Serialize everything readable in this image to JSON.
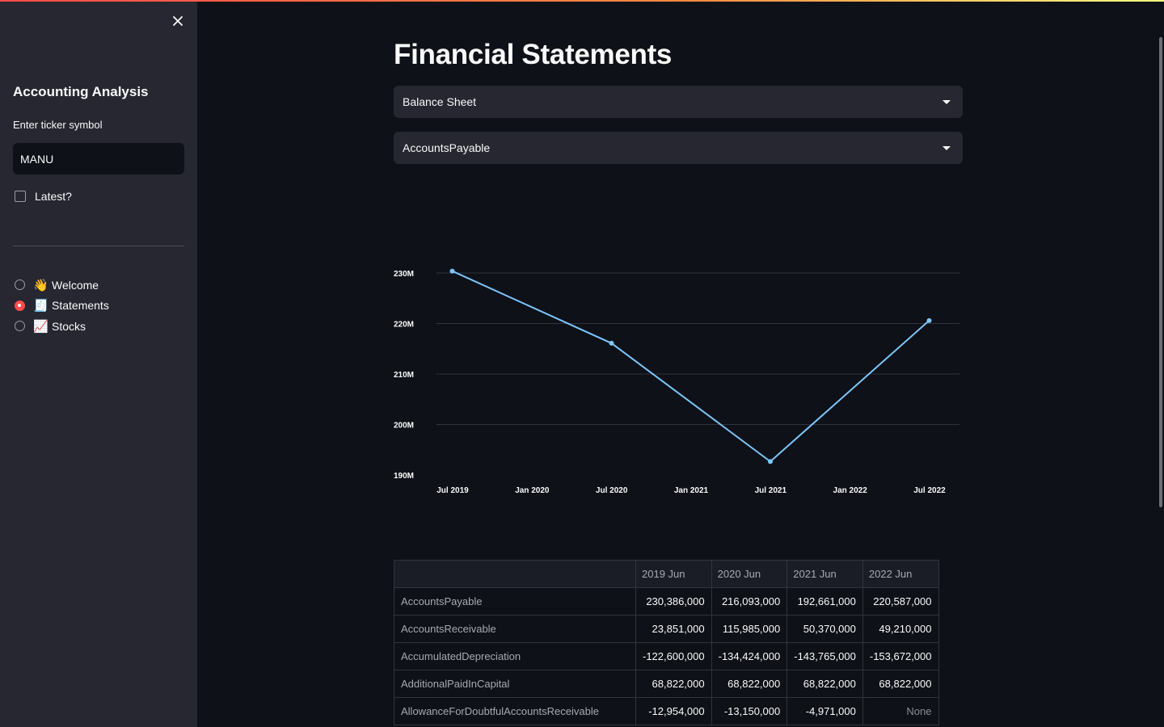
{
  "sidebar": {
    "title": "Accounting Analysis",
    "ticker_label": "Enter ticker symbol",
    "ticker_value": "MANU",
    "latest_label": "Latest?",
    "nav": [
      {
        "icon": "👋",
        "label": "Welcome",
        "selected": false
      },
      {
        "icon": "🧾",
        "label": "Statements",
        "selected": true
      },
      {
        "icon": "📈",
        "label": "Stocks",
        "selected": false
      }
    ]
  },
  "main": {
    "title": "Financial Statements",
    "statement_select": "Balance Sheet",
    "item_select": "AccountsPayable"
  },
  "chart_data": {
    "type": "line",
    "x": [
      "2019-06-30",
      "2020-06-30",
      "2021-06-30",
      "2022-06-30"
    ],
    "series": [
      {
        "values": [
          230386000,
          216093000,
          192661000,
          220587000
        ]
      }
    ],
    "x_tick_labels": [
      "Jul 2019",
      "Jan 2020",
      "Jul 2020",
      "Jan 2021",
      "Jul 2021",
      "Jan 2022",
      "Jul 2022"
    ],
    "y_tick_labels": [
      "190M",
      "200M",
      "210M",
      "220M",
      "230M"
    ],
    "ylim": [
      190000000,
      230000000
    ],
    "grid": true,
    "color": "#7cc6fe"
  },
  "table": {
    "columns": [
      "2019 Jun",
      "2020 Jun",
      "2021 Jun",
      "2022 Jun"
    ],
    "rows": [
      {
        "name": "AccountsPayable",
        "values": [
          "230,386,000",
          "216,093,000",
          "192,661,000",
          "220,587,000"
        ]
      },
      {
        "name": "AccountsReceivable",
        "values": [
          "23,851,000",
          "115,985,000",
          "50,370,000",
          "49,210,000"
        ]
      },
      {
        "name": "AccumulatedDepreciation",
        "values": [
          "-122,600,000",
          "-134,424,000",
          "-143,765,000",
          "-153,672,000"
        ]
      },
      {
        "name": "AdditionalPaidInCapital",
        "values": [
          "68,822,000",
          "68,822,000",
          "68,822,000",
          "68,822,000"
        ]
      },
      {
        "name": "AllowanceForDoubtfulAccountsReceivable",
        "values": [
          "-12,954,000",
          "-13,150,000",
          "-4,971,000",
          "None"
        ]
      }
    ]
  },
  "colors": {
    "accent": "#ff4b4b",
    "sidebar_bg": "#262730",
    "main_bg": "#0e1117",
    "line": "#7cc6fe"
  }
}
